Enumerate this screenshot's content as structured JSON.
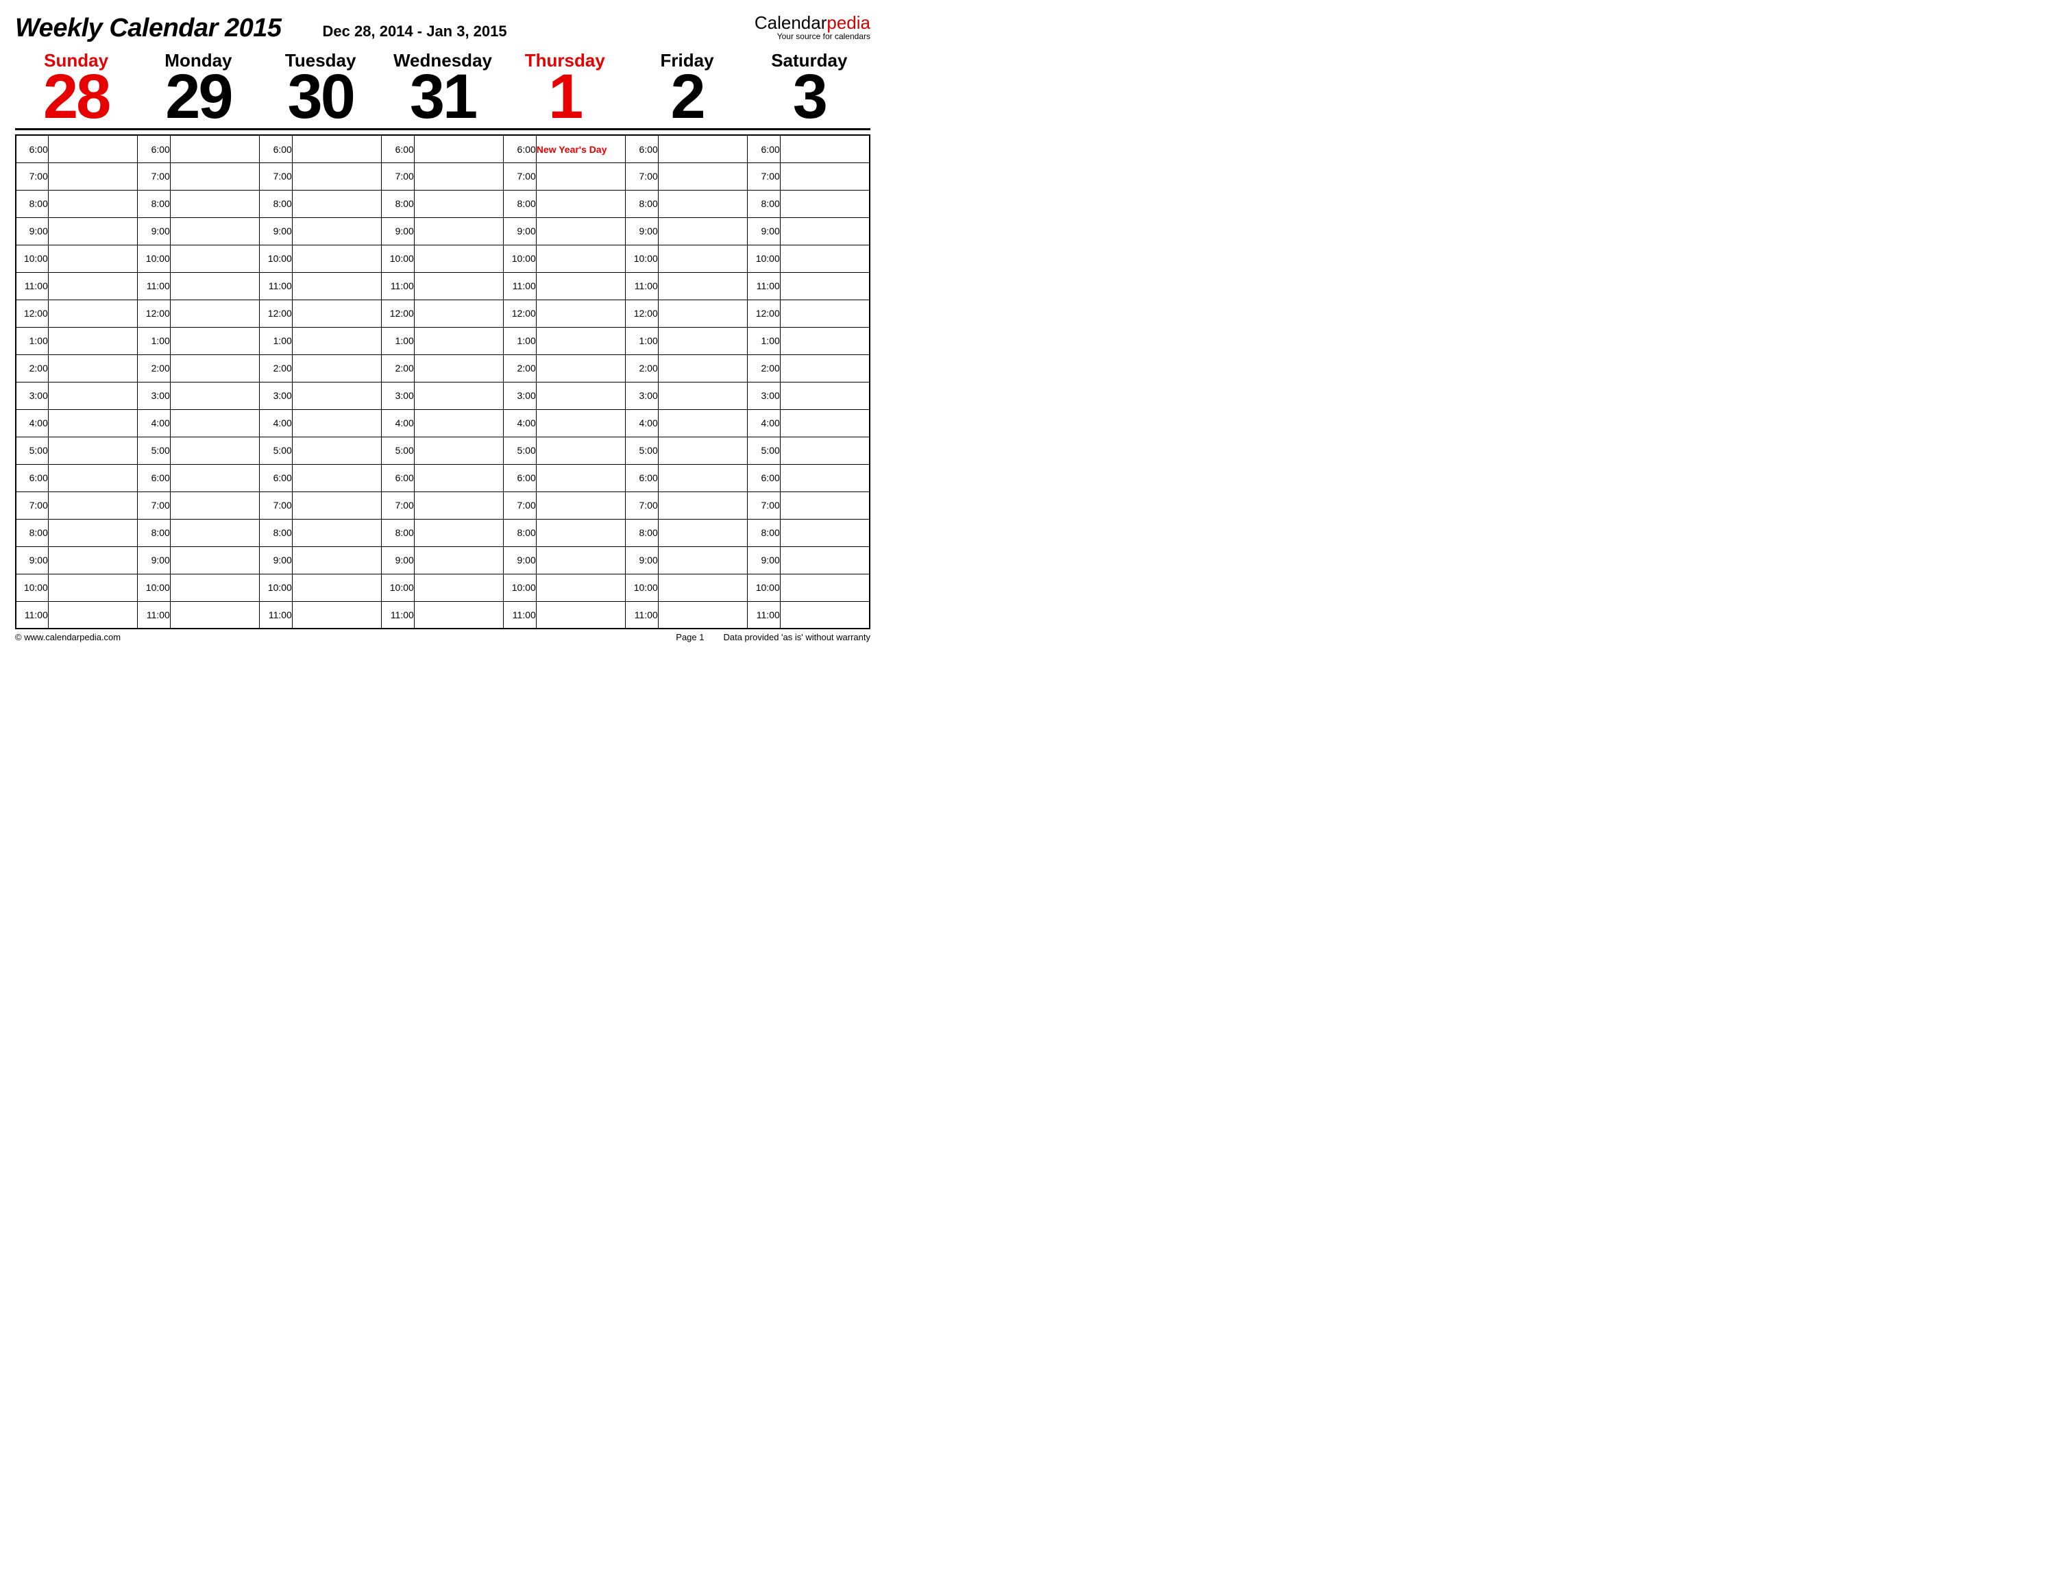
{
  "header": {
    "title": "Weekly Calendar 2015",
    "date_range": "Dec 28, 2014 - Jan 3, 2015",
    "brand_main_dark": "Calendar",
    "brand_main_red": "pedia",
    "brand_sub": "Your source for calendars"
  },
  "days": [
    {
      "name": "Sunday",
      "num": "28",
      "highlight": true
    },
    {
      "name": "Monday",
      "num": "29",
      "highlight": false
    },
    {
      "name": "Tuesday",
      "num": "30",
      "highlight": false
    },
    {
      "name": "Wednesday",
      "num": "31",
      "highlight": false
    },
    {
      "name": "Thursday",
      "num": "1",
      "highlight": true
    },
    {
      "name": "Friday",
      "num": "2",
      "highlight": false
    },
    {
      "name": "Saturday",
      "num": "3",
      "highlight": false
    }
  ],
  "hours": [
    "6:00",
    "7:00",
    "8:00",
    "9:00",
    "10:00",
    "11:00",
    "12:00",
    "1:00",
    "2:00",
    "3:00",
    "4:00",
    "5:00",
    "6:00",
    "7:00",
    "8:00",
    "9:00",
    "10:00",
    "11:00"
  ],
  "events": {
    "0": {
      "4": {
        "text": "New Year's Day",
        "red": true
      }
    }
  },
  "footer": {
    "copyright": "© www.calendarpedia.com",
    "page": "Page 1",
    "disclaimer": "Data provided 'as is' without warranty"
  }
}
